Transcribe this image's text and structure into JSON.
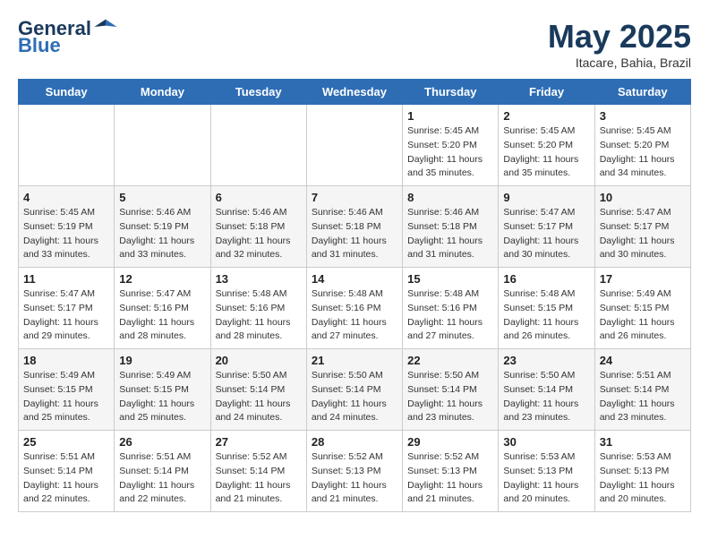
{
  "header": {
    "logo_line1": "General",
    "logo_line2": "Blue",
    "month": "May 2025",
    "location": "Itacare, Bahia, Brazil"
  },
  "days_of_week": [
    "Sunday",
    "Monday",
    "Tuesday",
    "Wednesday",
    "Thursday",
    "Friday",
    "Saturday"
  ],
  "weeks": [
    [
      {
        "day": "",
        "info": ""
      },
      {
        "day": "",
        "info": ""
      },
      {
        "day": "",
        "info": ""
      },
      {
        "day": "",
        "info": ""
      },
      {
        "day": "1",
        "info": "Sunrise: 5:45 AM\nSunset: 5:20 PM\nDaylight: 11 hours\nand 35 minutes."
      },
      {
        "day": "2",
        "info": "Sunrise: 5:45 AM\nSunset: 5:20 PM\nDaylight: 11 hours\nand 35 minutes."
      },
      {
        "day": "3",
        "info": "Sunrise: 5:45 AM\nSunset: 5:20 PM\nDaylight: 11 hours\nand 34 minutes."
      }
    ],
    [
      {
        "day": "4",
        "info": "Sunrise: 5:45 AM\nSunset: 5:19 PM\nDaylight: 11 hours\nand 33 minutes."
      },
      {
        "day": "5",
        "info": "Sunrise: 5:46 AM\nSunset: 5:19 PM\nDaylight: 11 hours\nand 33 minutes."
      },
      {
        "day": "6",
        "info": "Sunrise: 5:46 AM\nSunset: 5:18 PM\nDaylight: 11 hours\nand 32 minutes."
      },
      {
        "day": "7",
        "info": "Sunrise: 5:46 AM\nSunset: 5:18 PM\nDaylight: 11 hours\nand 31 minutes."
      },
      {
        "day": "8",
        "info": "Sunrise: 5:46 AM\nSunset: 5:18 PM\nDaylight: 11 hours\nand 31 minutes."
      },
      {
        "day": "9",
        "info": "Sunrise: 5:47 AM\nSunset: 5:17 PM\nDaylight: 11 hours\nand 30 minutes."
      },
      {
        "day": "10",
        "info": "Sunrise: 5:47 AM\nSunset: 5:17 PM\nDaylight: 11 hours\nand 30 minutes."
      }
    ],
    [
      {
        "day": "11",
        "info": "Sunrise: 5:47 AM\nSunset: 5:17 PM\nDaylight: 11 hours\nand 29 minutes."
      },
      {
        "day": "12",
        "info": "Sunrise: 5:47 AM\nSunset: 5:16 PM\nDaylight: 11 hours\nand 28 minutes."
      },
      {
        "day": "13",
        "info": "Sunrise: 5:48 AM\nSunset: 5:16 PM\nDaylight: 11 hours\nand 28 minutes."
      },
      {
        "day": "14",
        "info": "Sunrise: 5:48 AM\nSunset: 5:16 PM\nDaylight: 11 hours\nand 27 minutes."
      },
      {
        "day": "15",
        "info": "Sunrise: 5:48 AM\nSunset: 5:16 PM\nDaylight: 11 hours\nand 27 minutes."
      },
      {
        "day": "16",
        "info": "Sunrise: 5:48 AM\nSunset: 5:15 PM\nDaylight: 11 hours\nand 26 minutes."
      },
      {
        "day": "17",
        "info": "Sunrise: 5:49 AM\nSunset: 5:15 PM\nDaylight: 11 hours\nand 26 minutes."
      }
    ],
    [
      {
        "day": "18",
        "info": "Sunrise: 5:49 AM\nSunset: 5:15 PM\nDaylight: 11 hours\nand 25 minutes."
      },
      {
        "day": "19",
        "info": "Sunrise: 5:49 AM\nSunset: 5:15 PM\nDaylight: 11 hours\nand 25 minutes."
      },
      {
        "day": "20",
        "info": "Sunrise: 5:50 AM\nSunset: 5:14 PM\nDaylight: 11 hours\nand 24 minutes."
      },
      {
        "day": "21",
        "info": "Sunrise: 5:50 AM\nSunset: 5:14 PM\nDaylight: 11 hours\nand 24 minutes."
      },
      {
        "day": "22",
        "info": "Sunrise: 5:50 AM\nSunset: 5:14 PM\nDaylight: 11 hours\nand 23 minutes."
      },
      {
        "day": "23",
        "info": "Sunrise: 5:50 AM\nSunset: 5:14 PM\nDaylight: 11 hours\nand 23 minutes."
      },
      {
        "day": "24",
        "info": "Sunrise: 5:51 AM\nSunset: 5:14 PM\nDaylight: 11 hours\nand 23 minutes."
      }
    ],
    [
      {
        "day": "25",
        "info": "Sunrise: 5:51 AM\nSunset: 5:14 PM\nDaylight: 11 hours\nand 22 minutes."
      },
      {
        "day": "26",
        "info": "Sunrise: 5:51 AM\nSunset: 5:14 PM\nDaylight: 11 hours\nand 22 minutes."
      },
      {
        "day": "27",
        "info": "Sunrise: 5:52 AM\nSunset: 5:14 PM\nDaylight: 11 hours\nand 21 minutes."
      },
      {
        "day": "28",
        "info": "Sunrise: 5:52 AM\nSunset: 5:13 PM\nDaylight: 11 hours\nand 21 minutes."
      },
      {
        "day": "29",
        "info": "Sunrise: 5:52 AM\nSunset: 5:13 PM\nDaylight: 11 hours\nand 21 minutes."
      },
      {
        "day": "30",
        "info": "Sunrise: 5:53 AM\nSunset: 5:13 PM\nDaylight: 11 hours\nand 20 minutes."
      },
      {
        "day": "31",
        "info": "Sunrise: 5:53 AM\nSunset: 5:13 PM\nDaylight: 11 hours\nand 20 minutes."
      }
    ]
  ]
}
